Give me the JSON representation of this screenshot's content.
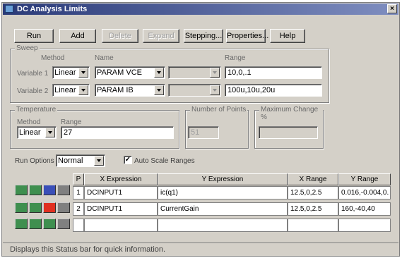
{
  "window": {
    "title": "DC Analysis Limits",
    "close_glyph": "×"
  },
  "toolbar": {
    "run": "Run",
    "add": "Add",
    "delete": "Delete",
    "expand": "Expand",
    "stepping": "Stepping...",
    "properties": "Properties...",
    "help": "Help"
  },
  "sweep": {
    "legend": "Sweep",
    "method_header": "Method",
    "name_header": "Name",
    "range_header": "Range",
    "variable1": {
      "label": "Variable 1",
      "method": "Linear",
      "name": "PARAM VCE",
      "range": "10,0,.1"
    },
    "variable2": {
      "label": "Variable 2",
      "method": "Linear",
      "name": "PARAM IB",
      "range": "100u,10u,20u"
    }
  },
  "temperature": {
    "legend": "Temperature",
    "method_header": "Method",
    "range_header": "Range",
    "method": "Linear",
    "range": "27"
  },
  "points": {
    "legend": "Number of Points",
    "value": "51"
  },
  "max_change": {
    "legend": "Maximum Change %",
    "value": ""
  },
  "run_options": {
    "label": "Run Options",
    "value": "Normal"
  },
  "auto_scale": {
    "label": "Auto Scale Ranges",
    "checked": true,
    "check_glyph": "✓"
  },
  "table": {
    "headers": {
      "p": "P",
      "x_expression": "X Expression",
      "y_expression": "Y Expression",
      "x_range": "X Range",
      "y_range": "Y Range"
    },
    "rows": [
      {
        "p": "1",
        "x_expression": "DCINPUT1",
        "y_expression": "ic(q1)",
        "x_range": "12.5,0,2.5",
        "y_range": "0.016,-0.004,0."
      },
      {
        "p": "2",
        "x_expression": "DCINPUT1",
        "y_expression": "CurrentGain",
        "x_range": "12.5,0,2.5",
        "y_range": "160,-40,40"
      },
      {
        "p": "",
        "x_expression": "",
        "y_expression": "",
        "x_range": "",
        "y_range": ""
      }
    ]
  },
  "colors": {
    "swatch_green": "#3f8f4f",
    "swatch_blue": "#3a4fb8",
    "swatch_red": "#e03020",
    "swatch_gray": "#808080"
  },
  "status": {
    "text": "Displays this Status bar for quick information."
  }
}
